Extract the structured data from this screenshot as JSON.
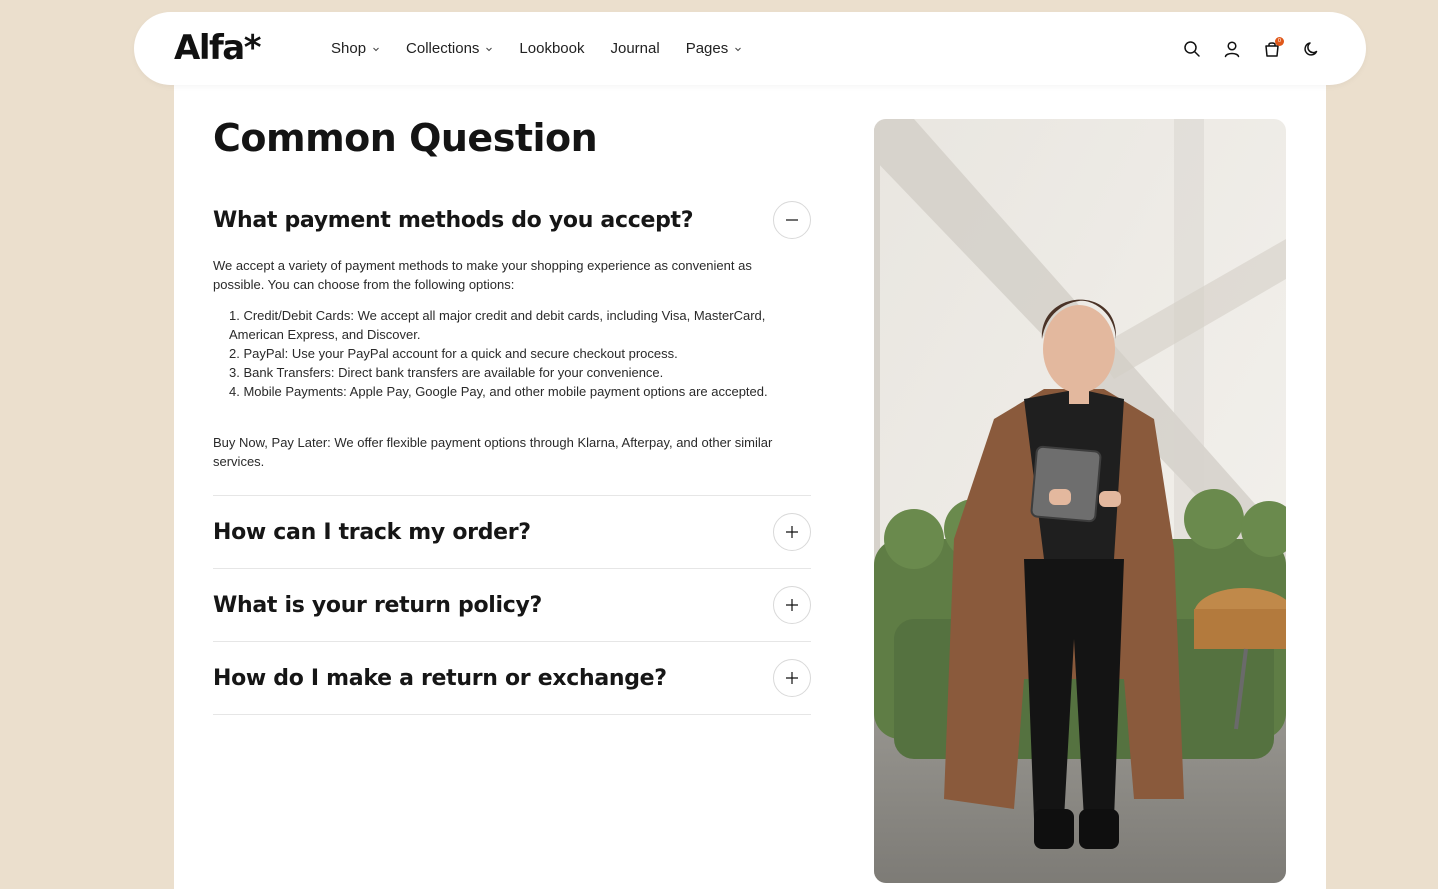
{
  "brand": {
    "logo": "Alfa*"
  },
  "nav": {
    "items": [
      {
        "label": "Shop",
        "dropdown": true
      },
      {
        "label": "Collections",
        "dropdown": true
      },
      {
        "label": "Lookbook",
        "dropdown": false
      },
      {
        "label": "Journal",
        "dropdown": false
      },
      {
        "label": "Pages",
        "dropdown": true
      }
    ]
  },
  "actions": {
    "icons": [
      "search-icon",
      "user-icon",
      "cart-icon",
      "moon-icon"
    ],
    "cart_count": "0"
  },
  "faq": {
    "title": "Common Question",
    "items": [
      {
        "question": "What payment methods do you accept?",
        "open": true,
        "intro": "We accept a variety of payment methods to make your shopping experience as convenient as possible. You can choose from the following options:",
        "options": [
          "1. Credit/Debit Cards: We accept all major credit and debit cards, including Visa, MasterCard, American Express, and Discover.",
          "2. PayPal: Use your PayPal account for a quick and secure checkout process.",
          "3. Bank Transfers: Direct bank transfers are available for your convenience.",
          "4. Mobile Payments: Apple Pay, Google Pay, and other mobile payment options are accepted."
        ],
        "outro": "Buy Now, Pay Later: We offer flexible payment options through Klarna, Afterpay, and other similar services."
      },
      {
        "question": "How can I track my order?",
        "open": false
      },
      {
        "question": "What is your return policy?",
        "open": false
      },
      {
        "question": "How do I make a return or exchange?",
        "open": false
      }
    ]
  },
  "colors": {
    "background": "#ebdfcd",
    "accent": "#e0581a",
    "coat": "#8a5a3c",
    "sofa": "#5f7d45"
  }
}
